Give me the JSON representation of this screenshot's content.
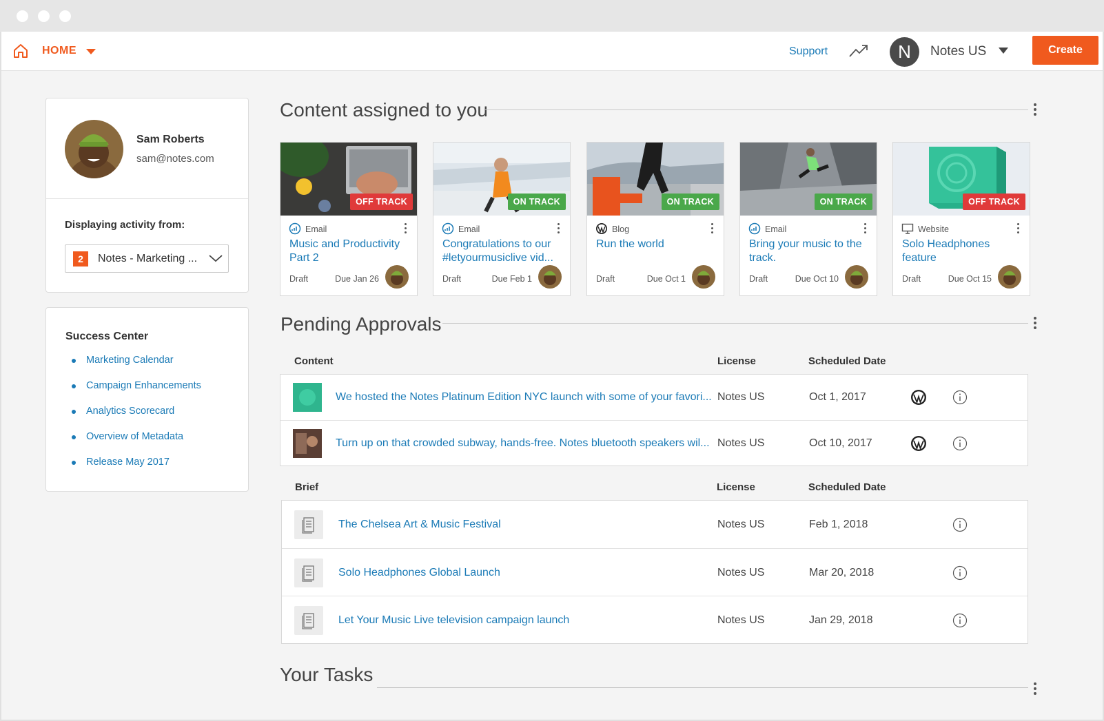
{
  "nav": {
    "home_label": "HOME",
    "support_label": "Support",
    "account_initial": "N",
    "account_name": "Notes  US",
    "create_label": "Create"
  },
  "profile": {
    "name": "Sam Roberts",
    "email": "sam@notes.com",
    "activity_label": "Displaying activity from:",
    "activity_count": "2",
    "activity_value": "Notes - Marketing ..."
  },
  "success_center": {
    "title": "Success Center",
    "links": [
      "Marketing Calendar",
      "Campaign Enhancements",
      "Analytics Scorecard",
      "Overview of Metadata",
      "Release May 2017"
    ]
  },
  "assigned": {
    "title": "Content assigned to you",
    "cards": [
      {
        "status": "OFF TRACK",
        "type": "Email",
        "type_icon": "email-icon",
        "title": "Music and Productivity Part 2",
        "state": "Draft",
        "due": "Due Jan 26"
      },
      {
        "status": "ON TRACK",
        "type": "Email",
        "type_icon": "email-icon",
        "title": "Congratulations to our #letyourmusiclive vid...",
        "state": "Draft",
        "due": "Due Feb 1"
      },
      {
        "status": "ON TRACK",
        "type": "Blog",
        "type_icon": "wordpress-icon",
        "title": "Run the world",
        "state": "Draft",
        "due": "Due Oct 1"
      },
      {
        "status": "ON TRACK",
        "type": "Email",
        "type_icon": "email-icon",
        "title": "Bring your music to the track.",
        "state": "Draft",
        "due": "Due Oct 10"
      },
      {
        "status": "OFF TRACK",
        "type": "Website",
        "type_icon": "monitor-icon",
        "title": "Solo Headphones feature",
        "state": "Draft",
        "due": "Due Oct 15"
      }
    ]
  },
  "pending": {
    "title": "Pending Approvals",
    "content_headers": {
      "content": "Content",
      "license": "License",
      "date": "Scheduled Date"
    },
    "content_rows": [
      {
        "title": "We hosted the Notes Platinum Edition NYC launch with some of your favori...",
        "license": "Notes US",
        "date": "Oct 1, 2017"
      },
      {
        "title": "Turn up on that crowded subway, hands-free. Notes bluetooth speakers wil...",
        "license": "Notes US",
        "date": "Oct 10, 2017"
      }
    ],
    "brief_headers": {
      "brief": "Brief",
      "license": "License",
      "date": "Scheduled Date"
    },
    "brief_rows": [
      {
        "title": "The Chelsea Art & Music Festival",
        "license": "Notes US",
        "date": "Feb 1, 2018"
      },
      {
        "title": "Solo Headphones Global Launch",
        "license": "Notes US",
        "date": "Mar 20, 2018"
      },
      {
        "title": "Let Your Music Live television campaign launch",
        "license": "Notes US",
        "date": "Jan 29, 2018"
      }
    ]
  },
  "tasks": {
    "title": "Your Tasks"
  },
  "colors": {
    "accent": "#f05a1e",
    "link": "#1a7ab6",
    "off_track": "#e03a3a",
    "on_track": "#4aa84a"
  }
}
